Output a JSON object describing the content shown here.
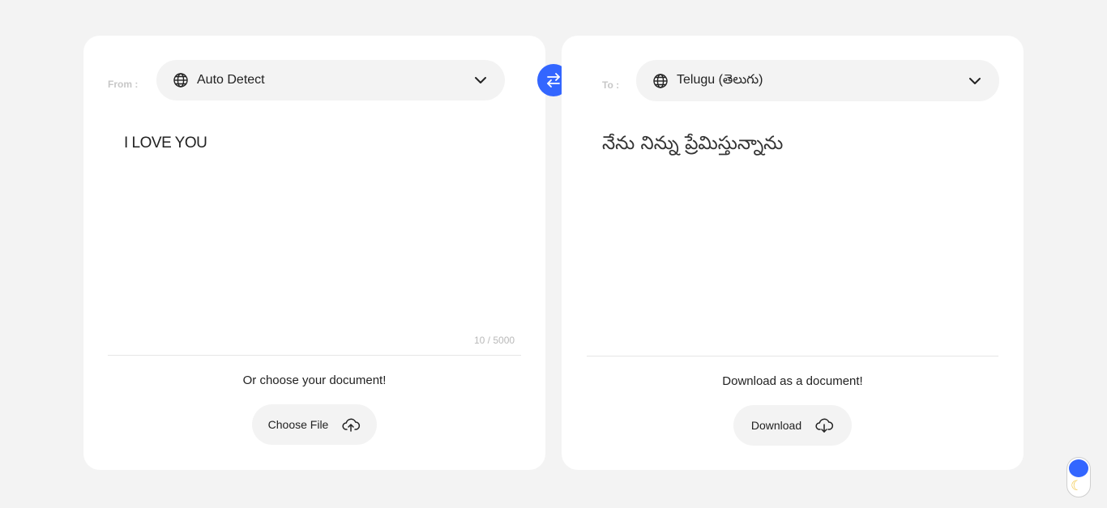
{
  "source": {
    "label": "From :",
    "language": "Auto Detect",
    "text": "I LOVE YOU",
    "char_count": "10 / 5000",
    "document_caption": "Or choose your document!",
    "choose_file_label": "Choose File"
  },
  "target": {
    "label": "To :",
    "language": "Telugu (తెలుగు)",
    "text": "నేను నిన్ను ప్రేమిస్తున్నాను",
    "document_caption": "Download as a document!",
    "download_label": "Download"
  },
  "theme_toggle": {
    "moon_glyph": "☾"
  },
  "colors": {
    "accent": "#3366ff",
    "page_bg": "#f3f3f3",
    "card_bg": "#ffffff"
  }
}
